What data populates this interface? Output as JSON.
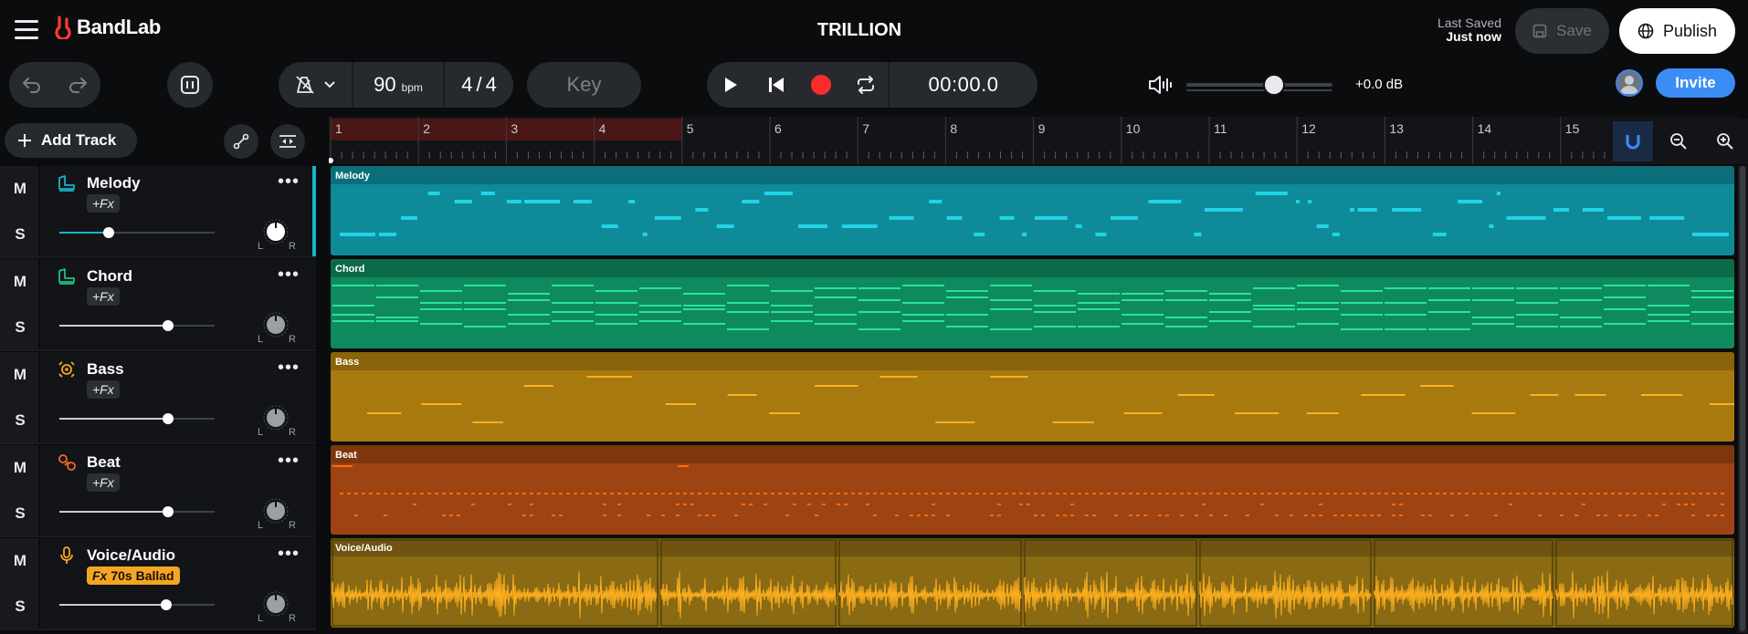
{
  "app": {
    "brand": "BandLab",
    "song_title": "TRILLION"
  },
  "header": {
    "last_saved_label": "Last Saved",
    "last_saved_value": "Just now",
    "save_label": "Save",
    "publish_label": "Publish"
  },
  "transport": {
    "tempo": "90",
    "tempo_unit": "bpm",
    "time_sig_top": "4",
    "time_sig_sep": "/",
    "time_sig_bottom": "4",
    "key_label": "Key",
    "time": "00:00.0",
    "volume_db": "+0.0 dB",
    "volume_level": 0.6,
    "invite_label": "Invite"
  },
  "tracks_panel": {
    "add_track_label": "Add Track"
  },
  "tracks": [
    {
      "name": "Melody",
      "fx": "+Fx",
      "mute": "M",
      "solo": "S",
      "pan_l": "L",
      "pan_r": "R",
      "fader": 0.32,
      "color": "#18b4c8",
      "lane_bg": "#0e8a99",
      "lane_head": "#0b6e7a",
      "note_color": "#22d3e6",
      "selected": true,
      "icon": "piano-icon"
    },
    {
      "name": "Chord",
      "fx": "+Fx",
      "mute": "M",
      "solo": "S",
      "pan_l": "L",
      "pan_r": "R",
      "fader": 0.7,
      "color": "#1cc287",
      "lane_bg": "#0f8a5e",
      "lane_head": "#0b6b49",
      "note_color": "#28e39b",
      "selected": false,
      "icon": "piano-icon"
    },
    {
      "name": "Bass",
      "fx": "+Fx",
      "mute": "M",
      "solo": "S",
      "pan_l": "L",
      "pan_r": "R",
      "fader": 0.7,
      "color": "#f5a524",
      "lane_bg": "#a8790e",
      "lane_head": "#8a630a",
      "note_color": "#ffb01f",
      "selected": false,
      "icon": "bass-icon"
    },
    {
      "name": "Beat",
      "fx": "+Fx",
      "mute": "M",
      "solo": "S",
      "pan_l": "L",
      "pan_r": "R",
      "fader": 0.7,
      "color": "#f26b1d",
      "lane_bg": "#9e4412",
      "lane_head": "#7e360d",
      "note_color": "#ff6a14",
      "selected": false,
      "icon": "beat-icon"
    },
    {
      "name": "Voice/Audio",
      "fx": "Fx 70s Ballad",
      "fx_prefix": "Fx",
      "fx_preset": "70s Ballad",
      "mute": "M",
      "solo": "S",
      "pan_l": "L",
      "pan_r": "R",
      "fader": 0.69,
      "color": "#f5a524",
      "lane_bg": "#8a6a12",
      "lane_head": "#6e540e",
      "note_color": "#ffb01f",
      "selected": false,
      "icon": "microphone-icon"
    }
  ],
  "ruler": {
    "bars": [
      "1",
      "2",
      "3",
      "4",
      "5",
      "6",
      "7",
      "8",
      "9",
      "10",
      "11",
      "12",
      "13",
      "14",
      "15"
    ],
    "loop_bars": 4
  },
  "colors": {
    "accent": "#3b8df5",
    "record": "#ff2b2b",
    "bg": "#0b0c0e",
    "panel": "#26292e"
  }
}
